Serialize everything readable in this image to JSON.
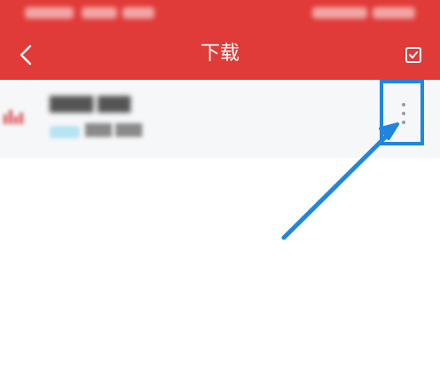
{
  "header": {
    "title": "下载"
  },
  "icons": {
    "back": "chevron-left-icon",
    "select": "checkbox-icon",
    "more": "more-vertical-icon",
    "annotation_arrow": "arrow-icon"
  },
  "colors": {
    "header_bg": "#e03b38",
    "row_bg": "#f6f7f9",
    "highlight": "#1f86e0"
  }
}
